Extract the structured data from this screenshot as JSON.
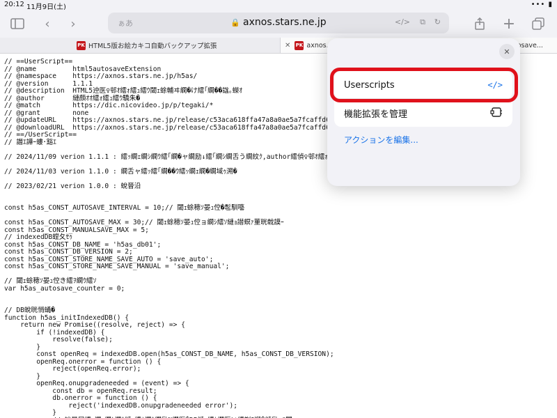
{
  "status": {
    "time": "20:12",
    "date": "11月9日(土)",
    "right": "••• ▮"
  },
  "address_bar": {
    "placeholder": "ぁあ",
    "url": "axnos.stars.ne.jp"
  },
  "tabs": [
    {
      "favicon": "PK",
      "label": "HTML5版お絵カキコ自動バックアップ拡張"
    },
    {
      "favicon": "PK",
      "label": "axnos.s"
    },
    {
      "label": "utosave..."
    }
  ],
  "popover": {
    "userscripts_label": "Userscripts",
    "userscripts_icon": "</>",
    "manage_label": "機能拡張を管理",
    "edit_actions_label": "アクションを編集..."
  },
  "code_lines": [
    "// ==UserScript==",
    "// @name         html5autosaveExtension",
    "// @namespace    https://axnos.stars.ne.jp/h5as/",
    "// @version      1.1.1",
    "// @description  HTML5迚医♀邨ｵ繧ｫ繧ｭ繧ｳ閾ｪ蜍輔ヰ繝�け繧｢繝��諡｡蠑ｵ",
    "// @author       縺顔ｵｵ繧ｫ繧ｭ繧ｳ驕朱�",
    "// @match        https://dic.nicovideo.jp/p/tegaki/*",
    "// @grant        none",
    "// @updateURL    https://axnos.stars.ne.jp/release/c53aca618ffa47a8a0ae5a7fcaffd6",
    "// @downloadURL  https://axnos.stars.ne.jp/release/c53aca618ffa47a8a0ae5a7fcaffd6",
    "// ==/UserScript==",
    "// 譖ｴ譁ｰ螻･豁ｴ",
    "",
    "// 2024/11/09 verion 1.1.1 : 繧ｯ繝ｪ繝ｼ繝ｳ繧｢繝�ャ繝励↓繧｢繝ｼ繝舌う繝紋ｸ,author繧偵♀邨ｵ繧ｫ繧ｭ",
    "",
    "// 2024/11/03 verion 1.1.0 : 繝舌ャ繧ｯ繧｢繝��ｳ繧ｯ繝ｪ繝�繝域ｩ溯�",
    "",
    "// 2023/02/21 verion 1.0.0 : 蛻晉沿",
    "",
    "",
    "const h5as_CONST_AUTOSAVE_INTERVAL = 10;// 閾ｪ蜍穂ｿ晏ｭ倥�髢馴囈",
    "",
    "const h5as_CONST_AUTOSAVE_MAX = 30;// 閾ｪ蜍穂ｿ晏ｭ倥ョ繝ｼ繧ｿ縺ｮ譛螟ｧ菫晄戟謨ｰ",
    "const h5as_CONST_MANUALSAVE_MAX = 5;",
    "// indexedDB螳夂ｾｩ",
    "const h5as_CONST_DB_NAME = 'h5as_db01';",
    "const h5as_CONST_DB_VERSION = 2;",
    "const h5as_CONST_STORE_NAME_SAVE_AUTO = 'save_auto';",
    "const h5as_CONST_STORE_NAME_SAVE_MANUAL = 'save_manual';",
    "",
    "// 閾ｪ蜍穂ｿ晏ｭ倥き繧ｦ繝ｳ繧ｿ",
    "var h5as_autosave_counter = 0;",
    "",
    "",
    "// DB蛻晄悄蛹�",
    "function h5as_initIndexedDB() {",
    "    return new Promise((resolve, reject) => {",
    "        if (!indexedDB) {",
    "            resolve(false);",
    "        }",
    "        const openReq = indexedDB.open(h5as_CONST_DB_NAME, h5as_CONST_DB_VERSION);",
    "        openReq.onerror = function () {",
    "            reject(openReq.error);",
    "        }",
    "        openReq.onupgradeneeded = (event) => {",
    "            const db = openReq.result;",
    "            db.onerror = function () {",
    "                reject('indexedDB.onupgradeneeded error');",
    "            }",
    "            // 蛻晏屓繧ｯ繝ｪ繝ｼ繝ｳ縺ｪ繧ｷ繝ｳ繝励Ν繝医�DB縺ｮ繧ｹ繝医い繧剃ｽ懈�縺励∵ｺ門ｙ"
  ]
}
